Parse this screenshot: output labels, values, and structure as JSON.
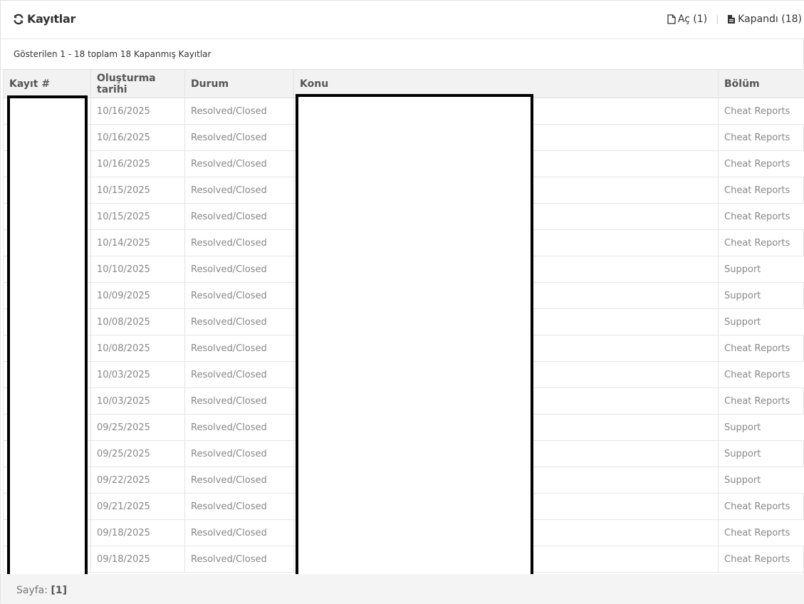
{
  "header": {
    "title": "Kayıtlar",
    "filters": [
      {
        "label": "Aç (1)"
      },
      {
        "label": "Kapandı (18)"
      }
    ],
    "separator": "|"
  },
  "summary": "Gösterilen 1 - 18 toplam 18 Kapanmış Kayıtlar",
  "table": {
    "columns": [
      "Kayıt #",
      "Oluşturma tarihi",
      "Durum",
      "Konu",
      "Bölüm"
    ],
    "rows": [
      {
        "date": "10/16/2025",
        "status": "Resolved/Closed",
        "dept": "Cheat Reports"
      },
      {
        "date": "10/16/2025",
        "status": "Resolved/Closed",
        "dept": "Cheat Reports"
      },
      {
        "date": "10/16/2025",
        "status": "Resolved/Closed",
        "dept": "Cheat Reports"
      },
      {
        "date": "10/15/2025",
        "status": "Resolved/Closed",
        "dept": "Cheat Reports"
      },
      {
        "date": "10/15/2025",
        "status": "Resolved/Closed",
        "dept": "Cheat Reports"
      },
      {
        "date": "10/14/2025",
        "status": "Resolved/Closed",
        "dept": "Cheat Reports"
      },
      {
        "date": "10/10/2025",
        "status": "Resolved/Closed",
        "dept": "Support"
      },
      {
        "date": "10/09/2025",
        "status": "Resolved/Closed",
        "dept": "Support"
      },
      {
        "date": "10/08/2025",
        "status": "Resolved/Closed",
        "dept": "Support"
      },
      {
        "date": "10/08/2025",
        "status": "Resolved/Closed",
        "dept": "Cheat Reports"
      },
      {
        "date": "10/03/2025",
        "status": "Resolved/Closed",
        "dept": "Cheat Reports"
      },
      {
        "date": "10/03/2025",
        "status": "Resolved/Closed",
        "dept": "Cheat Reports"
      },
      {
        "date": "09/25/2025",
        "status": "Resolved/Closed",
        "dept": "Support"
      },
      {
        "date": "09/25/2025",
        "status": "Resolved/Closed",
        "dept": "Support"
      },
      {
        "date": "09/22/2025",
        "status": "Resolved/Closed",
        "dept": "Support"
      },
      {
        "date": "09/21/2025",
        "status": "Resolved/Closed",
        "dept": "Cheat Reports"
      },
      {
        "date": "09/18/2025",
        "status": "Resolved/Closed",
        "dept": "Cheat Reports"
      },
      {
        "date": "09/18/2025",
        "status": "Resolved/Closed",
        "dept": "Cheat Reports"
      }
    ]
  },
  "pager": {
    "label": "Sayfa:",
    "current": "[1]"
  },
  "icons": {
    "title": "refresh-icon",
    "open": "file-outline-icon",
    "closed": "file-text-icon"
  }
}
